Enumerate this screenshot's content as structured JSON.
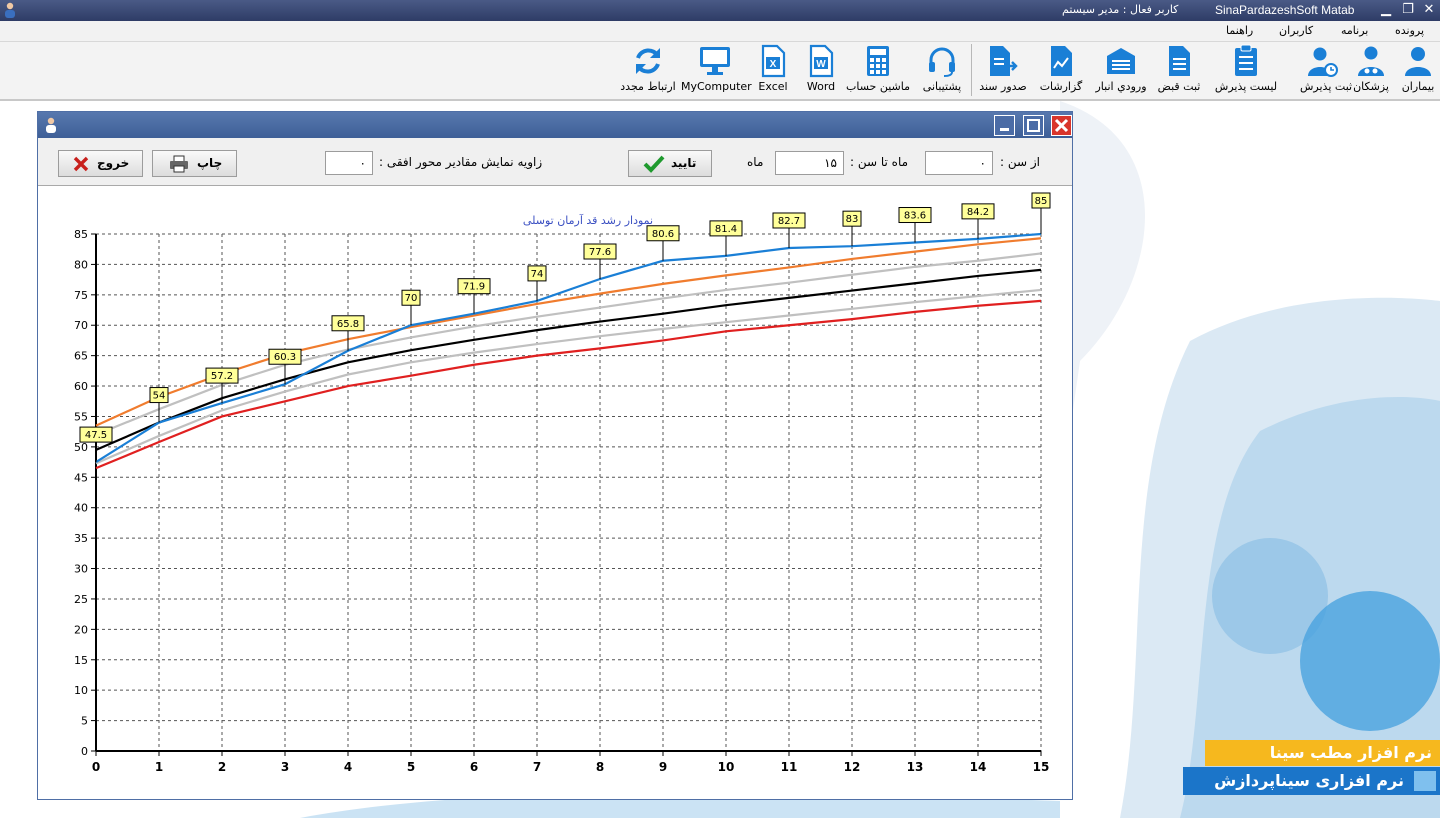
{
  "titlebar": {
    "app_title": "SinaPardazeshSoft Matab",
    "user_label": "کاربر فعال : مدیر سیستم"
  },
  "menu": [
    "پرونده",
    "برنامه",
    "کاربران",
    "راهنما"
  ],
  "toolbar": {
    "patients": "بیماران",
    "doctors": "پزشکان",
    "register_admission": "ثبت پذیرش",
    "admission_list": "لیست پذیرش",
    "register_receipt": "ثبت قبض",
    "warehouse_entry": "ورودي انبار",
    "reports": "گزارشات",
    "issue_document": "صدور سند",
    "support": "پشتیبانی",
    "calculator": "ماشین حساب",
    "word": "Word",
    "excel": "Excel",
    "mycomputer": "MyComputer",
    "reconnect": "ارتباط مجدد"
  },
  "brand": {
    "line1": "نرم افزار مطب سینا",
    "line2": "نرم افزاری سیناپردازش"
  },
  "controls": {
    "from_age_label": "از سن :",
    "from_age_value": "۰",
    "to_age_label": "ماه تا سن :",
    "to_age_value": "۱۵",
    "month_label": "ماه",
    "confirm_label": "تایید",
    "angle_label": "زاویه نمایش مقادیر محور افقی :",
    "angle_value": "۰",
    "print_label": "چاپ",
    "exit_label": "خروج"
  },
  "colors": {
    "patient": "#1a7fd6",
    "p97": "#f07c2e",
    "p85": "#c0c0c0",
    "p50": "#000000",
    "p15": "#c0c0c0",
    "p3": "#e02020",
    "label_bg": "#ffff99"
  },
  "chart_data": {
    "type": "line",
    "title": "نمودار رشد قد آرمان توسلی",
    "xlabel": "",
    "ylabel": "",
    "xlim": [
      0,
      15
    ],
    "ylim": [
      0,
      85
    ],
    "x_ticks": [
      0,
      1,
      2,
      3,
      4,
      5,
      6,
      7,
      8,
      9,
      10,
      11,
      12,
      13,
      14,
      15
    ],
    "y_ticks": [
      0,
      5,
      10,
      15,
      20,
      25,
      30,
      35,
      40,
      45,
      50,
      55,
      60,
      65,
      70,
      75,
      80,
      85
    ],
    "grid": true,
    "series": [
      {
        "color": "#f07c2e",
        "x": [
          0,
          1,
          2,
          3,
          4,
          5,
          6,
          7,
          8,
          9,
          10,
          11,
          12,
          13,
          14,
          15
        ],
        "values": [
          53.5,
          58.2,
          62,
          65.3,
          67.7,
          69.7,
          71.6,
          73.5,
          75.2,
          76.8,
          78.2,
          79.5,
          80.9,
          82.1,
          83.3,
          84.3
        ]
      },
      {
        "color": "#c0c0c0",
        "x": [
          0,
          1,
          2,
          3,
          4,
          5,
          6,
          7,
          8,
          9,
          10,
          11,
          12,
          13,
          14,
          15
        ],
        "values": [
          52,
          56.2,
          60.2,
          63.5,
          66,
          68,
          69.8,
          71.4,
          72.9,
          74.4,
          75.8,
          77,
          78.3,
          79.6,
          80.6,
          81.8
        ]
      },
      {
        "color": "#000000",
        "x": [
          0,
          1,
          2,
          3,
          4,
          5,
          6,
          7,
          8,
          9,
          10,
          11,
          12,
          13,
          14,
          15
        ],
        "values": [
          49.5,
          54,
          58,
          61.1,
          63.9,
          65.9,
          67.6,
          69.2,
          70.6,
          71.9,
          73.3,
          74.5,
          75.7,
          76.9,
          78.1,
          79.1
        ]
      },
      {
        "color": "#c0c0c0",
        "x": [
          0,
          1,
          2,
          3,
          4,
          5,
          6,
          7,
          8,
          9,
          10,
          11,
          12,
          13,
          14,
          15
        ],
        "values": [
          47.3,
          51.8,
          56,
          59.1,
          61.9,
          63.9,
          65.5,
          66.9,
          68.2,
          69.4,
          70.5,
          71.6,
          72.7,
          73.8,
          74.8,
          75.8
        ]
      },
      {
        "color": "#e02020",
        "x": [
          0,
          1,
          2,
          3,
          4,
          5,
          6,
          7,
          8,
          9,
          10,
          11,
          12,
          13,
          14,
          15
        ],
        "values": [
          46.5,
          50.8,
          55,
          57.5,
          60,
          61.7,
          63.5,
          65,
          66.2,
          67.5,
          69,
          70,
          71,
          72.2,
          73.2,
          74
        ]
      },
      {
        "color": "#1a7fd6",
        "x": [
          0,
          1,
          2,
          3,
          4,
          5,
          6,
          7,
          8,
          9,
          10,
          11,
          12,
          13,
          14,
          15
        ],
        "values": [
          47.5,
          54,
          57.2,
          60.3,
          65.8,
          70,
          71.9,
          74,
          77.6,
          80.6,
          81.4,
          82.7,
          83,
          83.6,
          84.2,
          85
        ],
        "labels": [
          "47.5",
          "54",
          "57.2",
          "60.3",
          "65.8",
          "70",
          "71.9",
          "74",
          "77.6",
          "80.6",
          "81.4",
          "82.7",
          "83",
          "83.6",
          "84.2",
          "85"
        ]
      }
    ]
  }
}
